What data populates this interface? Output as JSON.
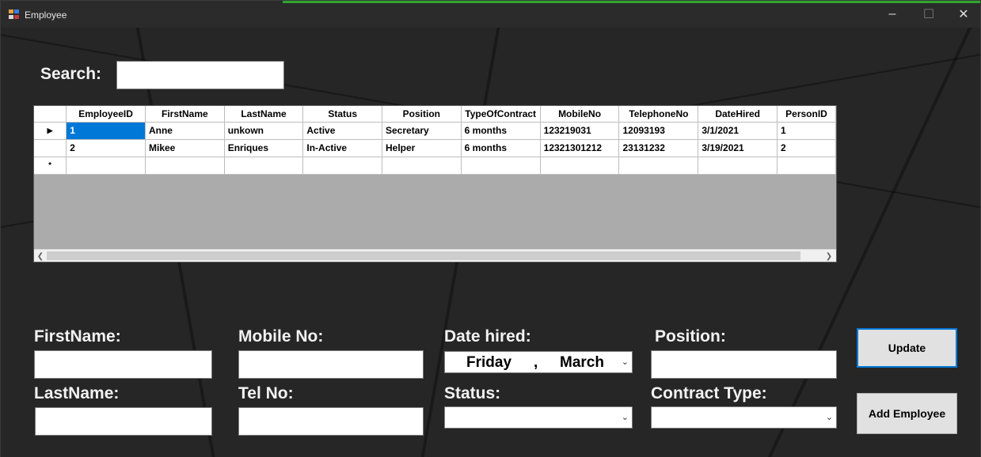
{
  "window": {
    "title": "Employee",
    "accent": "#2fa52f"
  },
  "search": {
    "label": "Search:",
    "value": ""
  },
  "grid": {
    "columns": [
      "EmployeeID",
      "FirstName",
      "LastName",
      "Status",
      "Position",
      "TypeOfContract",
      "MobileNo",
      "TelephoneNo",
      "DateHired",
      "PersonID"
    ],
    "rows": [
      [
        "1",
        "Anne",
        "unkown",
        "Active",
        "Secretary",
        "6 months",
        "123219031",
        "12093193",
        "3/1/2021",
        "1"
      ],
      [
        "2",
        "Mikee",
        "Enriques",
        "In-Active",
        "Helper",
        "6 months",
        "12321301212",
        "23131232",
        "3/19/2021",
        "2"
      ]
    ],
    "new_row_marker": "*",
    "current_row_marker": "▶",
    "selection_color": "#0078d7"
  },
  "form": {
    "firstname_label": "FirstName:",
    "lastname_label": "LastName:",
    "mobile_label": "Mobile No:",
    "tel_label": "Tel No:",
    "date_label": "Date hired:",
    "date_day": "Friday",
    "date_sep": ",",
    "date_month": "March",
    "status_label": "Status:",
    "position_label": "Position:",
    "contract_label": "Contract Type:"
  },
  "buttons": {
    "update": "Update",
    "add": "Add Employee"
  }
}
